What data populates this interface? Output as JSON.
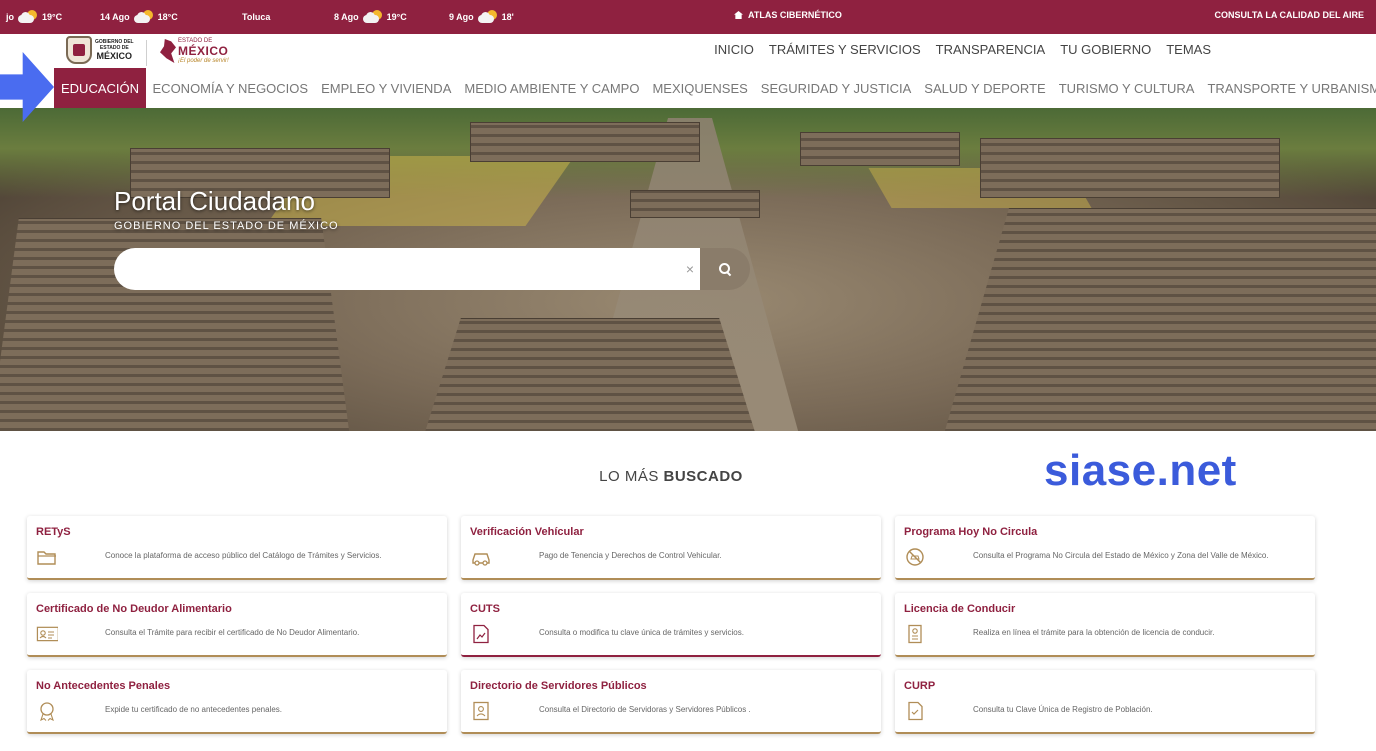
{
  "topbar": {
    "weather": [
      {
        "place": "jo",
        "temp": "19°C"
      },
      {
        "place": "14 Ago",
        "temp": "18°C"
      },
      {
        "place": "Toluca",
        "temp": ""
      },
      {
        "place": "8 Ago",
        "temp": "19°C"
      },
      {
        "place": "9 Ago",
        "temp": "18'"
      }
    ],
    "atlas": "ATLAS CIBERNÉTICO",
    "calidad": "CONSULTA LA CALIDAD DEL AIRE"
  },
  "header": {
    "gob_logo": {
      "line1": "GOBIERNO DEL",
      "line2": "ESTADO DE",
      "line3": "MÉXICO"
    },
    "edo_logo": {
      "small": "ESTADO DE",
      "big": "MÉXICO",
      "tag": "¡El poder de servir!"
    },
    "topnav": [
      "INICIO",
      "TRÁMITES Y SERVICIOS",
      "TRANSPARENCIA",
      "TU GOBIERNO",
      "TEMAS"
    ],
    "mainnav": [
      "EDUCACIÓN",
      "ECONOMÍA Y NEGOCIOS",
      "EMPLEO Y VIVIENDA",
      "MEDIO AMBIENTE Y CAMPO",
      "MEXIQUENSES",
      "SEGURIDAD Y JUSTICIA",
      "SALUD Y DEPORTE",
      "TURISMO Y CULTURA",
      "TRANSPORTE Y URBANISMO"
    ],
    "active_nav": "EDUCACIÓN"
  },
  "hero": {
    "title": "Portal Ciudadano",
    "subtitle": "GOBIERNO DEL ESTADO DE MÉXICO",
    "search": {
      "value": "",
      "placeholder": "",
      "clear": "×"
    }
  },
  "section": {
    "title_prefix": "LO MÁS ",
    "title_bold": "BUSCADO"
  },
  "watermark": "siase.net",
  "cards": [
    {
      "title": "RETyS",
      "desc": "Conoce la plataforma de acceso público del Catálogo de Trámites y Servicios.",
      "icon": "folder-icon"
    },
    {
      "title": "Verificación Vehícular",
      "desc": "Pago de Tenencia y Derechos de Control Vehicular.",
      "icon": "car-icon"
    },
    {
      "title": "Programa Hoy No Circula",
      "desc": "Consulta el Programa No Circula del Estado de México y Zona del Valle de México.",
      "icon": "no-circula-icon"
    },
    {
      "title": "Certificado de No Deudor Alimentario",
      "desc": "Consulta el Trámite para recibir el certificado de No Deudor Alimentario.",
      "icon": "id-card-icon"
    },
    {
      "title": "CUTS",
      "desc": "Consulta o modifica tu clave única de trámites y servicios.",
      "icon": "document-chart-icon"
    },
    {
      "title": "Licencia de Conducir",
      "desc": "Realiza en línea el trámite para la obtención de licencia de conducir.",
      "icon": "license-icon"
    },
    {
      "title": "No Antecedentes Penales",
      "desc": "Expide tu certificado de no antecedentes penales.",
      "icon": "certificate-icon"
    },
    {
      "title": "Directorio de Servidores Públicos",
      "desc": "Consulta el Directorio de Servidoras y Servidores Públicos .",
      "icon": "directory-icon"
    },
    {
      "title": "CURP",
      "desc": "Consulta tu Clave Única de Registro de Población.",
      "icon": "curp-document-icon"
    }
  ],
  "colors": {
    "brand": "#8f2140",
    "accent_gold": "#b08d57",
    "watermark": "#3b5bdb",
    "arrow": "#4a6cf0"
  }
}
